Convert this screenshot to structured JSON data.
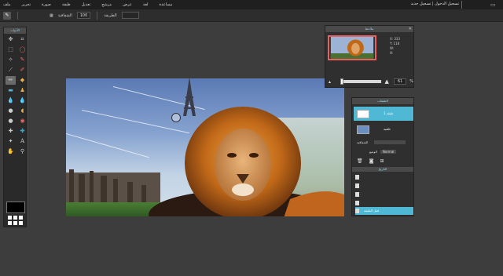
{
  "menu": {
    "items": [
      "ملف",
      "تحرير",
      "صورة",
      "طبقة",
      "تعديل",
      "مرشح",
      "عرض",
      "لغة",
      "مساعدة"
    ],
    "title": "تسجيل الدخول | تسجيل جديد"
  },
  "options": {
    "opacity_label": "الشفافية",
    "opacity_value": "100",
    "mode_label": "الطريقة"
  },
  "tools": {
    "title": "الأدوات",
    "icons": [
      "move-icon",
      "crop-icon",
      "marquee-icon",
      "lasso-icon",
      "wand-icon",
      "pencil-icon",
      "brush-icon",
      "eraser-icon",
      "selected-tool-icon",
      "fill-icon",
      "gradient-icon",
      "stamp-icon",
      "drop-icon",
      "blur-icon",
      "dodge-icon",
      "burn-icon",
      "sponge-icon",
      "red-eye-icon",
      "heal-icon",
      "smudge-icon",
      "shape-icon",
      "type-icon",
      "hand-icon",
      "zoom-icon"
    ]
  },
  "navigator": {
    "title": "ملاحظ",
    "x_label": "X:",
    "x_value": "333",
    "y_label": "Y:",
    "y_value": "118",
    "w_label": "W:",
    "h_label": "H:",
    "zoom_value": "61",
    "zoom_unit": "%"
  },
  "layers": {
    "title": "الطبقات",
    "items": [
      {
        "name": "طبقة 1",
        "selected": true
      },
      {
        "name": "خلفية",
        "selected": false
      }
    ],
    "opacity_label": "الشفافية",
    "mode_label": "الوضع",
    "mode_value": "Normal"
  },
  "history": {
    "title": "التاريخ",
    "items": [
      "",
      "",
      "",
      "",
      "قفل الطبقة"
    ]
  },
  "colors": {
    "accent": "#4fb8d4",
    "background": "#3d3d3d",
    "panel": "#2f2f2f"
  }
}
